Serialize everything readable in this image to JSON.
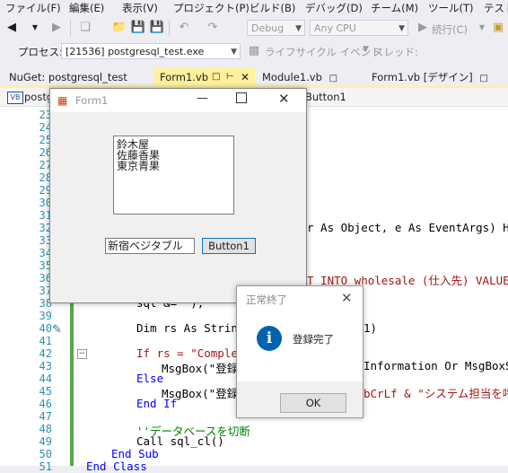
{
  "menu": [
    "ファイル(F)",
    "編集(E)",
    "表示(V)",
    "プロジェクト(P)",
    "ビルド(B)",
    "デバッグ(D)",
    "チーム(M)",
    "ツール(T)",
    "テスト"
  ],
  "toolbar": {
    "config": "Debug",
    "platform": "Any CPU",
    "continue_label": "続行(C)"
  },
  "toolbar2": {
    "process_label": "プロセス:",
    "process_value": "[21536] postgresql_test.exe",
    "lifecycle_label": "ライフサイクル イベント",
    "thread_label": "スレッド:"
  },
  "tabs": [
    "NuGet: postgresql_test",
    "Form1.vb",
    "Module1.vb",
    "Form1.vb [デザイン]"
  ],
  "navbar": {
    "lang_badge": "VB",
    "left_item": "postg",
    "right_item": "Button1"
  },
  "line_numbers": [
    "23",
    "24",
    "25",
    "26",
    "27",
    "28",
    "29",
    "30",
    "31",
    "32",
    "33",
    "34",
    "35",
    "36",
    "37",
    "38",
    "39",
    "40",
    "41",
    "42",
    "43",
    "44",
    "45",
    "46",
    "47",
    "48",
    "49",
    "50",
    "51"
  ],
  "code": {
    "l32": "r As Object, e As EventArgs) Han",
    "l36": "T INTO wholesale (仕入先) VALUES",
    "l38": "sql &= \");\"",
    "l40a": "Dim rs As String",
    "l40b": "1)",
    "l42a": "If rs = \"Complet",
    "l43a": "MsgBox(\"登録",
    "l43b": "Information Or MsgBoxSty",
    "l44": "Else",
    "l45a": "MsgBox(\"登録",
    "l45b": "bCrLf & \"システム担当を呼",
    "l46": "End If",
    "l48": "''データベースを切断",
    "l49": "Call sql_cl()",
    "l50": "End Sub",
    "l51": "End Class"
  },
  "form1": {
    "title": "Form1",
    "list_items": [
      "鈴木屋",
      "佐藤香果",
      "東京青果"
    ],
    "textbox_value": "新宿ベジタブル",
    "button_label": "Button1"
  },
  "msgbox": {
    "title": "正常終了",
    "message": "登録完了",
    "ok_label": "OK"
  },
  "colors": {
    "accent": "#0078d7",
    "tab_active": "#fff29d",
    "change_bar": "#57a64a"
  }
}
